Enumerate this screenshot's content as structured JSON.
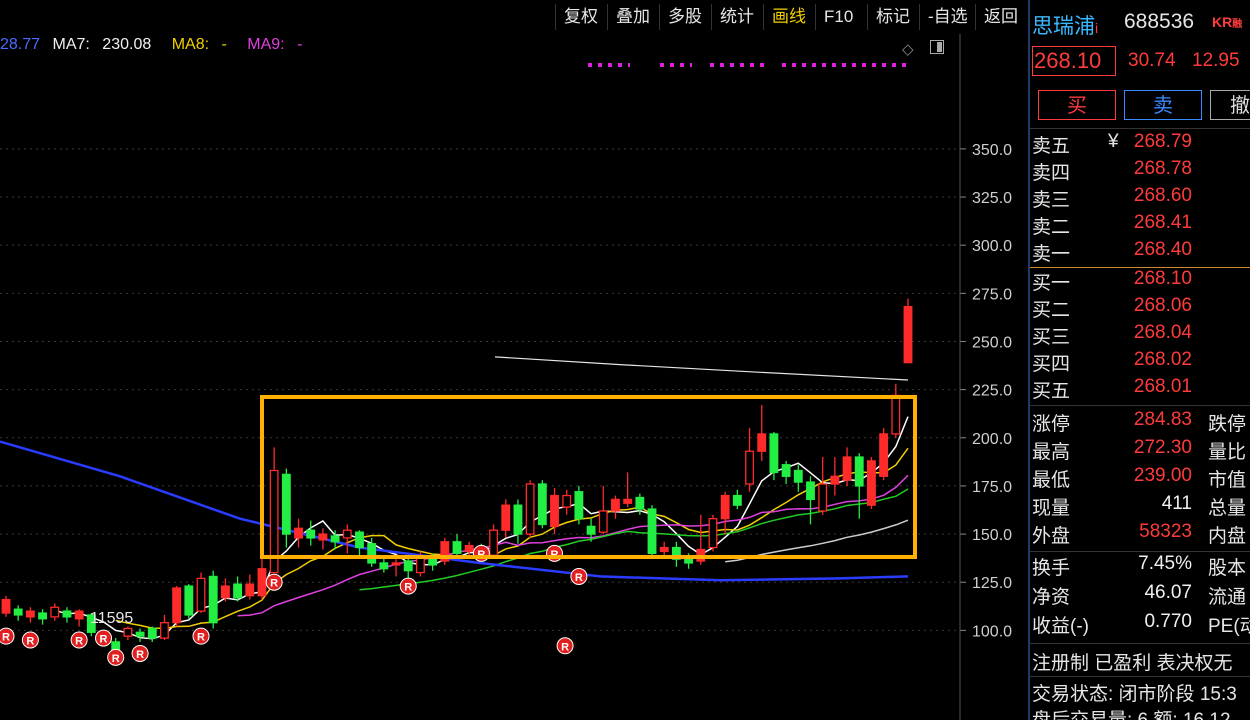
{
  "toolbar": [
    "复权",
    "叠加",
    "多股",
    "统计",
    "画线",
    "F10",
    "标记",
    "-自选",
    "返回"
  ],
  "toolbar_active": "画线",
  "ma_legend": {
    "ma5": "28.77",
    "ma7_label": "MA7:",
    "ma7_value": "230.08",
    "ma8_label": "MA8:",
    "ma8_value": "-",
    "ma9_label": "MA9:",
    "ma9_value": "-"
  },
  "volume_marker": "11595",
  "chart_data": {
    "type": "candlestick",
    "title": "",
    "ylim": [
      95,
      365
    ],
    "yticks": [
      100.0,
      125.0,
      150.0,
      175.0,
      200.0,
      225.0,
      250.0,
      275.0,
      300.0,
      325.0,
      350.0
    ],
    "ytick_labels": [
      "100.0",
      "125.0",
      "150.0",
      "175.0",
      "200.0",
      "225.0",
      "250.0",
      "275.0",
      "300.0",
      "325.0",
      "350.0"
    ],
    "candles": [
      {
        "o": 109,
        "c": 116,
        "h": 118,
        "l": 107
      },
      {
        "o": 111,
        "c": 108,
        "h": 113,
        "l": 105
      },
      {
        "o": 107,
        "c": 110,
        "h": 112,
        "l": 104
      },
      {
        "o": 109,
        "c": 106,
        "h": 111,
        "l": 103
      },
      {
        "o": 107,
        "c": 112,
        "h": 114,
        "l": 105
      },
      {
        "o": 110,
        "c": 107,
        "h": 112,
        "l": 104
      },
      {
        "o": 106,
        "c": 110,
        "h": 111,
        "l": 102
      },
      {
        "o": 108,
        "c": 99,
        "h": 109,
        "l": 97
      },
      {
        "o": 99,
        "c": 94,
        "h": 100,
        "l": 92
      },
      {
        "o": 94,
        "c": 90,
        "h": 96,
        "l": 88
      },
      {
        "o": 97,
        "c": 101,
        "h": 102,
        "l": 95
      },
      {
        "o": 99,
        "c": 97,
        "h": 101,
        "l": 94
      },
      {
        "o": 101,
        "c": 96,
        "h": 102,
        "l": 94
      },
      {
        "o": 96,
        "c": 104,
        "h": 108,
        "l": 95
      },
      {
        "o": 104,
        "c": 122,
        "h": 123,
        "l": 102
      },
      {
        "o": 123,
        "c": 108,
        "h": 124,
        "l": 106
      },
      {
        "o": 110,
        "c": 127,
        "h": 130,
        "l": 109
      },
      {
        "o": 128,
        "c": 104,
        "h": 131,
        "l": 101
      },
      {
        "o": 117,
        "c": 123,
        "h": 127,
        "l": 115
      },
      {
        "o": 124,
        "c": 117,
        "h": 128,
        "l": 115
      },
      {
        "o": 118,
        "c": 124,
        "h": 129,
        "l": 116
      },
      {
        "o": 118,
        "c": 132,
        "h": 138,
        "l": 116
      },
      {
        "o": 130,
        "c": 183,
        "h": 195,
        "l": 130
      },
      {
        "o": 181,
        "c": 150,
        "h": 184,
        "l": 143
      },
      {
        "o": 148,
        "c": 153,
        "h": 158,
        "l": 143
      },
      {
        "o": 152,
        "c": 148,
        "h": 157,
        "l": 144
      },
      {
        "o": 147,
        "c": 150,
        "h": 153,
        "l": 142
      },
      {
        "o": 149,
        "c": 146,
        "h": 152,
        "l": 142
      },
      {
        "o": 148,
        "c": 152,
        "h": 155,
        "l": 140
      },
      {
        "o": 151,
        "c": 143,
        "h": 152,
        "l": 139
      },
      {
        "o": 145,
        "c": 135,
        "h": 148,
        "l": 133
      },
      {
        "o": 135,
        "c": 132,
        "h": 138,
        "l": 130
      },
      {
        "o": 134,
        "c": 135,
        "h": 137,
        "l": 128
      },
      {
        "o": 136,
        "c": 131,
        "h": 138,
        "l": 127
      },
      {
        "o": 130,
        "c": 138,
        "h": 141,
        "l": 128
      },
      {
        "o": 138,
        "c": 134,
        "h": 140,
        "l": 131
      },
      {
        "o": 136,
        "c": 146,
        "h": 148,
        "l": 134
      },
      {
        "o": 146,
        "c": 140,
        "h": 150,
        "l": 138
      },
      {
        "o": 141,
        "c": 144,
        "h": 146,
        "l": 139
      },
      {
        "o": 143,
        "c": 138,
        "h": 145,
        "l": 136
      },
      {
        "o": 139,
        "c": 152,
        "h": 155,
        "l": 138
      },
      {
        "o": 152,
        "c": 165,
        "h": 168,
        "l": 148
      },
      {
        "o": 165,
        "c": 150,
        "h": 168,
        "l": 145
      },
      {
        "o": 150,
        "c": 176,
        "h": 178,
        "l": 148
      },
      {
        "o": 176,
        "c": 155,
        "h": 178,
        "l": 153
      },
      {
        "o": 154,
        "c": 170,
        "h": 174,
        "l": 150
      },
      {
        "o": 164,
        "c": 170,
        "h": 173,
        "l": 160
      },
      {
        "o": 172,
        "c": 158,
        "h": 175,
        "l": 155
      },
      {
        "o": 154,
        "c": 150,
        "h": 158,
        "l": 146
      },
      {
        "o": 151,
        "c": 162,
        "h": 175,
        "l": 150
      },
      {
        "o": 162,
        "c": 168,
        "h": 170,
        "l": 158
      },
      {
        "o": 166,
        "c": 168,
        "h": 182,
        "l": 164
      },
      {
        "o": 169,
        "c": 163,
        "h": 171,
        "l": 160
      },
      {
        "o": 163,
        "c": 140,
        "h": 165,
        "l": 138
      },
      {
        "o": 141,
        "c": 143,
        "h": 146,
        "l": 139
      },
      {
        "o": 143,
        "c": 137,
        "h": 146,
        "l": 133
      },
      {
        "o": 138,
        "c": 135,
        "h": 140,
        "l": 132
      },
      {
        "o": 136,
        "c": 142,
        "h": 160,
        "l": 134
      },
      {
        "o": 143,
        "c": 158,
        "h": 160,
        "l": 141
      },
      {
        "o": 158,
        "c": 170,
        "h": 172,
        "l": 150
      },
      {
        "o": 170,
        "c": 165,
        "h": 173,
        "l": 163
      },
      {
        "o": 176,
        "c": 193,
        "h": 205,
        "l": 172
      },
      {
        "o": 193,
        "c": 202,
        "h": 217,
        "l": 188
      },
      {
        "o": 202,
        "c": 182,
        "h": 203,
        "l": 178
      },
      {
        "o": 186,
        "c": 180,
        "h": 188,
        "l": 176
      },
      {
        "o": 183,
        "c": 177,
        "h": 186,
        "l": 172
      },
      {
        "o": 177,
        "c": 168,
        "h": 180,
        "l": 155
      },
      {
        "o": 162,
        "c": 176,
        "h": 190,
        "l": 160
      },
      {
        "o": 176,
        "c": 180,
        "h": 190,
        "l": 170
      },
      {
        "o": 178,
        "c": 190,
        "h": 195,
        "l": 175
      },
      {
        "o": 190,
        "c": 175,
        "h": 192,
        "l": 158
      },
      {
        "o": 165,
        "c": 188,
        "h": 190,
        "l": 163
      },
      {
        "o": 180,
        "c": 202,
        "h": 205,
        "l": 178
      },
      {
        "o": 202,
        "c": 222,
        "h": 228,
        "l": 200
      },
      {
        "o": 239,
        "c": 268.1,
        "h": 272.3,
        "l": 239
      }
    ]
  },
  "stock": {
    "name": "思瑞浦",
    "name_suffix": "i",
    "code": "688536",
    "tags": "KR",
    "tags_small": "融",
    "price": "268.10",
    "change": "30.74",
    "change_pct": "12.95"
  },
  "buttons": {
    "buy": "买",
    "sell": "卖",
    "cancel": "撤"
  },
  "asks": [
    {
      "label": "卖五",
      "mark": "¥",
      "price": "268.79"
    },
    {
      "label": "卖四",
      "price": "268.78"
    },
    {
      "label": "卖三",
      "price": "268.60"
    },
    {
      "label": "卖二",
      "price": "268.41"
    },
    {
      "label": "卖一",
      "price": "268.40"
    }
  ],
  "bids": [
    {
      "label": "买一",
      "price": "268.10"
    },
    {
      "label": "买二",
      "price": "268.06"
    },
    {
      "label": "买三",
      "price": "268.04"
    },
    {
      "label": "买四",
      "price": "268.02"
    },
    {
      "label": "买五",
      "price": "268.01"
    }
  ],
  "stats": [
    {
      "label": "涨停",
      "value": "284.83",
      "color": "red",
      "ext": "跌停"
    },
    {
      "label": "最高",
      "value": "272.30",
      "color": "red",
      "ext": "量比"
    },
    {
      "label": "最低",
      "value": "239.00",
      "color": "red",
      "ext": "市值"
    },
    {
      "label": "现量",
      "value": "411",
      "color": "white",
      "ext": "总量"
    },
    {
      "label": "外盘",
      "value": "58323",
      "color": "red",
      "ext": "内盘"
    }
  ],
  "stats2": [
    {
      "label": "换手",
      "value": "7.45%",
      "ext": "股本"
    },
    {
      "label": "净资",
      "value": "46.07",
      "ext": "流通"
    },
    {
      "label": "收益(-)",
      "value": "0.770",
      "ext": "PE(动"
    }
  ],
  "flags": "注册制 已盈利 表决权无",
  "trade_status": "交易状态: 闭市阶段 15:3",
  "after_hours": "盘后交易量: 6  额: 16.12"
}
